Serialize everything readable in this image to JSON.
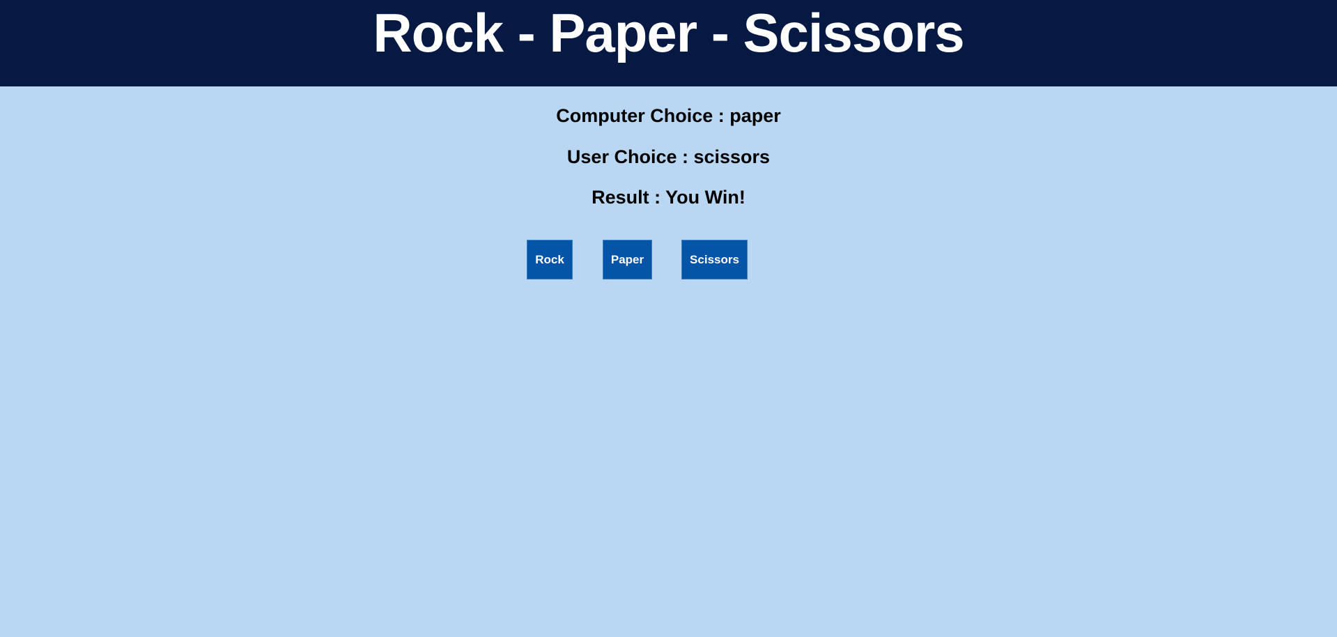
{
  "header": {
    "title": "Rock - Paper - Scissors"
  },
  "status": {
    "computer_choice": "Computer Choice : paper",
    "user_choice": "User Choice : scissors",
    "result": "Result : You Win!"
  },
  "buttons": {
    "rock": "Rock",
    "paper": "Paper",
    "scissors": "Scissors"
  },
  "colors": {
    "header_bg": "#051942",
    "page_bg": "#b9d7f2",
    "button_bg": "#0454a7",
    "button_text": "#ffffff"
  }
}
